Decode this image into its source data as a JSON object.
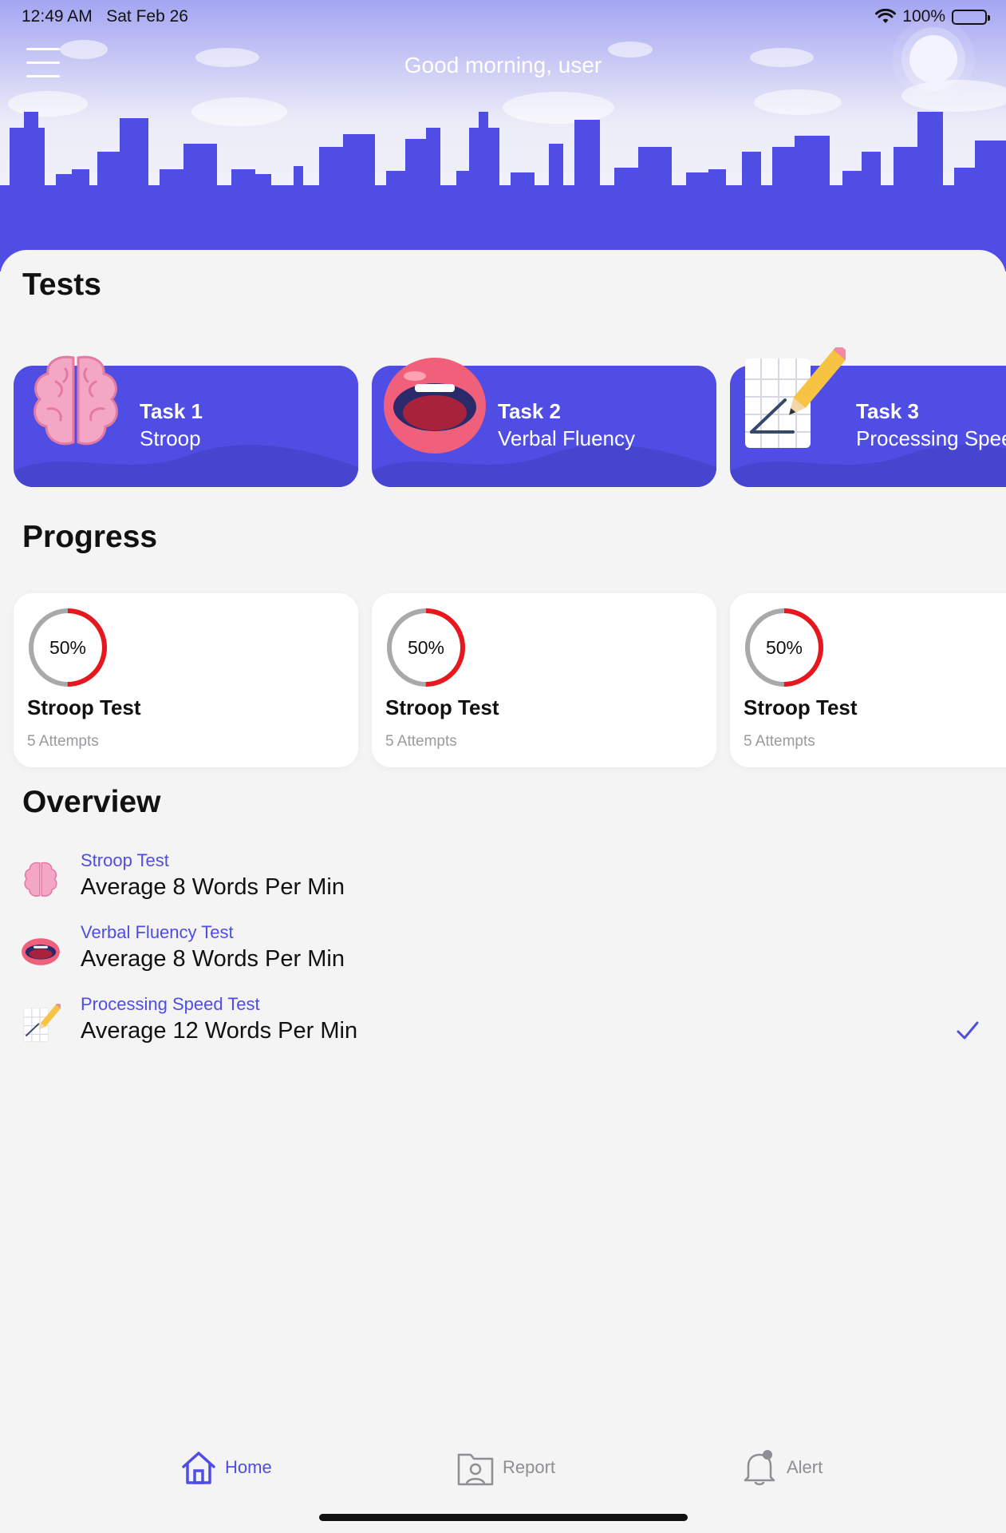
{
  "status_bar": {
    "time": "12:49 AM",
    "date": "Sat Feb 26",
    "battery": "100%"
  },
  "header": {
    "greeting": "Good morning, user"
  },
  "colors": {
    "accent": "#4f4de3",
    "ring_progress": "#e8171d",
    "ring_track": "#a9a9ab"
  },
  "sections": {
    "tests": "Tests",
    "progress": "Progress",
    "overview": "Overview"
  },
  "tasks": [
    {
      "title": "Task 1",
      "subtitle": "Stroop",
      "icon": "brain-icon"
    },
    {
      "title": "Task 2",
      "subtitle": "Verbal Fluency",
      "icon": "mouth-icon"
    },
    {
      "title": "Task 3",
      "subtitle": "Processing Speed",
      "icon": "notepad-pencil-icon"
    }
  ],
  "progress": [
    {
      "percent": 50,
      "percent_label": "50%",
      "title": "Stroop Test",
      "attempts": "5 Attempts"
    },
    {
      "percent": 50,
      "percent_label": "50%",
      "title": "Stroop Test",
      "attempts": "5 Attempts"
    },
    {
      "percent": 50,
      "percent_label": "50%",
      "title": "Stroop Test",
      "attempts": "5 Attempts"
    }
  ],
  "overview": [
    {
      "label": "Stroop Test",
      "value": "Average 8 Words Per Min",
      "icon": "brain-icon",
      "checked": false
    },
    {
      "label": "Verbal Fluency Test",
      "value": "Average 8 Words Per Min",
      "icon": "mouth-icon",
      "checked": false
    },
    {
      "label": "Processing Speed Test",
      "value": "Average 12 Words Per Min",
      "icon": "notepad-pencil-icon",
      "checked": true
    }
  ],
  "tabbar": {
    "home": "Home",
    "report": "Report",
    "alert": "Alert"
  }
}
